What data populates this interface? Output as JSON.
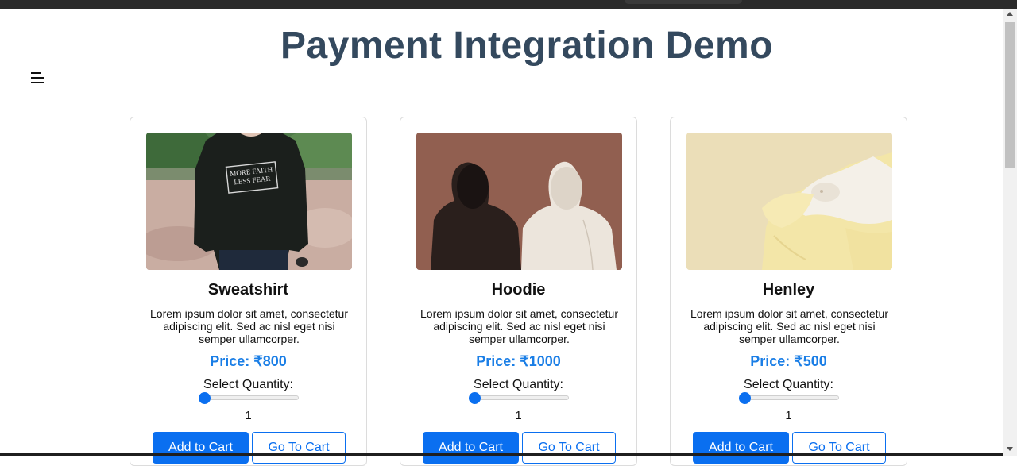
{
  "page": {
    "title": "Payment Integration Demo",
    "menu_icon": "hamburger-menu-icon"
  },
  "colors": {
    "title": "#34495e",
    "price": "#1a7ee6",
    "primary": "#0a6ff0"
  },
  "products": [
    {
      "name": "Sweatshirt",
      "description": "Lorem ipsum dolor sit amet, consectetur adipiscing elit. Sed ac nisl eget nisi semper ullamcorper.",
      "price_label": "Price:",
      "price_value": "₹800",
      "quantity_label": "Select Quantity:",
      "quantity": "1",
      "add_label": "Add to Cart",
      "go_label": "Go To Cart",
      "image": "black-sweatshirt-photo"
    },
    {
      "name": "Hoodie",
      "description": "Lorem ipsum dolor sit amet, consectetur adipiscing elit. Sed ac nisl eget nisi semper ullamcorper.",
      "price_label": "Price:",
      "price_value": "₹1000",
      "quantity_label": "Select Quantity:",
      "quantity": "1",
      "add_label": "Add to Cart",
      "go_label": "Go To Cart",
      "image": "two-hoodies-photo"
    },
    {
      "name": "Henley",
      "description": "Lorem ipsum dolor sit amet, consectetur adipiscing elit. Sed ac nisl eget nisi semper ullamcorper.",
      "price_label": "Price:",
      "price_value": "₹500",
      "quantity_label": "Select Quantity:",
      "quantity": "1",
      "add_label": "Add to Cart",
      "go_label": "Go To Cart",
      "image": "folded-henley-shirts-photo"
    }
  ],
  "photo_texts": {
    "sweatshirt_print_line1": "MORE FAITH",
    "sweatshirt_print_line2": "LESS FEAR"
  }
}
